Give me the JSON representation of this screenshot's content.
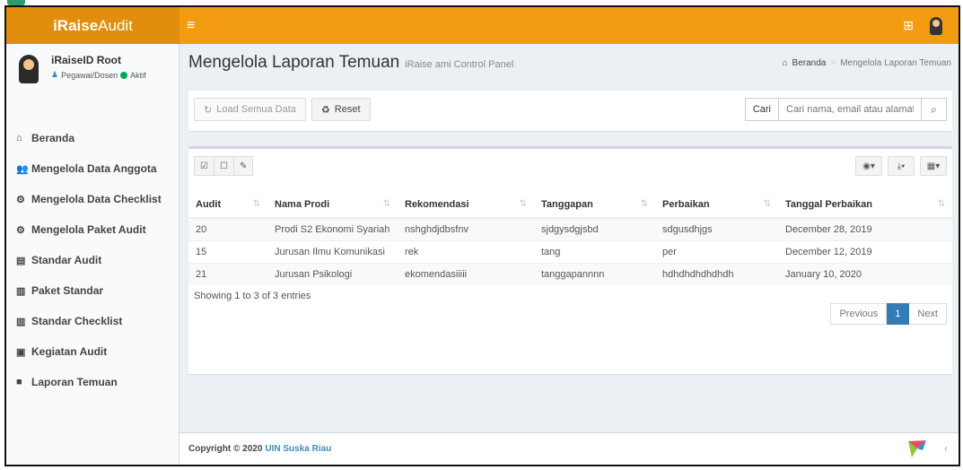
{
  "brand": {
    "bold": "iRaise",
    "rest": "Audit"
  },
  "topbar": {
    "menu_icon": "≡",
    "apps_icon": "⊞"
  },
  "user": {
    "name": "iRaiseID Root",
    "role": "Pegawai/Dosen",
    "status": "Aktif"
  },
  "menu": [
    {
      "icon": "home-icon",
      "glyph": "⌂",
      "label": "Beranda"
    },
    {
      "icon": "users-icon",
      "glyph": "👥",
      "label": "Mengelola Data Anggota"
    },
    {
      "icon": "cogs-icon",
      "glyph": "⚙",
      "label": "Mengelola Data Checklist"
    },
    {
      "icon": "cogs-icon",
      "glyph": "⚙",
      "label": "Mengelola Paket Audit"
    },
    {
      "icon": "book-icon",
      "glyph": "▤",
      "label": "Standar Audit"
    },
    {
      "icon": "bar-chart-icon",
      "glyph": "▥",
      "label": "Paket Standar"
    },
    {
      "icon": "bar-chart-icon",
      "glyph": "▥",
      "label": "Standar Checklist"
    },
    {
      "icon": "id-card-icon",
      "glyph": "▣",
      "label": "Kegiatan Audit"
    },
    {
      "icon": "folder-icon",
      "glyph": "■",
      "label": "Laporan Temuan"
    }
  ],
  "header": {
    "title": "Mengelola Laporan Temuan",
    "subtitle": "iRaise ami Control Panel"
  },
  "breadcrumb": {
    "home": "Beranda",
    "current": "Mengelola Laporan Temuan"
  },
  "actions": {
    "load_all": "Load Semua Data",
    "reset": "Reset"
  },
  "search": {
    "label": "Cari",
    "placeholder": "Cari nama, email atau alamat..."
  },
  "table": {
    "columns": [
      "Audit",
      "Nama Prodi",
      "Rekomendasi",
      "Tanggapan",
      "Perbaikan",
      "Tanggal Perbaikan"
    ],
    "rows": [
      [
        "20",
        "Prodi S2 Ekonomi Syariah",
        "nshghdjdbsfnv",
        "sjdgysdgjsbd",
        "sdgusdhjgs",
        "December 28, 2019"
      ],
      [
        "15",
        "Jurusan Ilmu Komunikasi",
        "rek",
        "tang",
        "per",
        "December 12, 2019"
      ],
      [
        "21",
        "Jurusan Psikologi",
        "ekomendasiiiii",
        "tanggapannnn",
        "hdhdhdhdhdhdh",
        "January 10, 2020"
      ]
    ]
  },
  "summary": "Showing 1 to 3 of 3 entries",
  "pagination": {
    "prev": "Previous",
    "current": "1",
    "next": "Next"
  },
  "footer": {
    "text": "Copyright © 2020",
    "link": "UIN Suska Riau"
  },
  "colors": {
    "topbar": "#f39c12",
    "accent": "#3c8dbc",
    "active_page": "#337ab7"
  }
}
